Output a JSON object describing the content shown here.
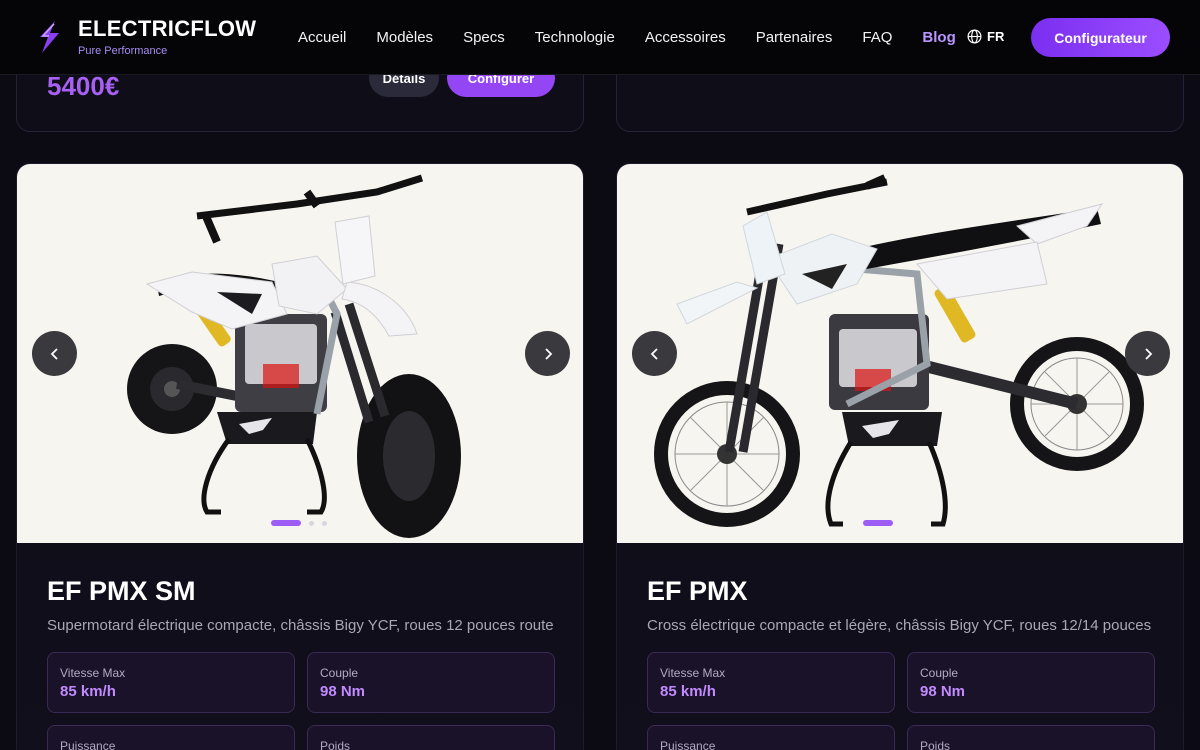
{
  "brand": {
    "name": "ELECTRICFLOW",
    "tagline": "Pure Performance"
  },
  "nav": {
    "items": [
      "Accueil",
      "Modèles",
      "Specs",
      "Technologie",
      "Accessoires",
      "Partenaires",
      "FAQ",
      "Blog"
    ],
    "active": "Blog"
  },
  "language": "FR",
  "cta_label": "Configurateur",
  "previous_card": {
    "price": "5400€",
    "details_label": "Détails",
    "configure_label": "Configurer"
  },
  "products": [
    {
      "title": "EF PMX SM",
      "description": "Supermotard électrique compacte, châssis Bigy YCF, roues 12 pouces route",
      "specs": [
        {
          "label": "Vitesse Max",
          "value": "85 km/h"
        },
        {
          "label": "Couple",
          "value": "98 Nm"
        },
        {
          "label": "Puissance",
          "value": ""
        },
        {
          "label": "Poids",
          "value": ""
        }
      ]
    },
    {
      "title": "EF PMX",
      "description": "Cross électrique compacte et légère, châssis Bigy YCF, roues 12/14 pouces",
      "specs": [
        {
          "label": "Vitesse Max",
          "value": "85 km/h"
        },
        {
          "label": "Couple",
          "value": "98 Nm"
        },
        {
          "label": "Puissance",
          "value": ""
        },
        {
          "label": "Poids",
          "value": ""
        }
      ]
    }
  ],
  "colors": {
    "accent": "#9446f5",
    "price": "#a660f2",
    "spec_value": "#c18bff",
    "background": "#0c0b14"
  },
  "icons": [
    "bolt-logo-icon",
    "globe-icon",
    "chevron-left-icon",
    "chevron-right-icon"
  ]
}
